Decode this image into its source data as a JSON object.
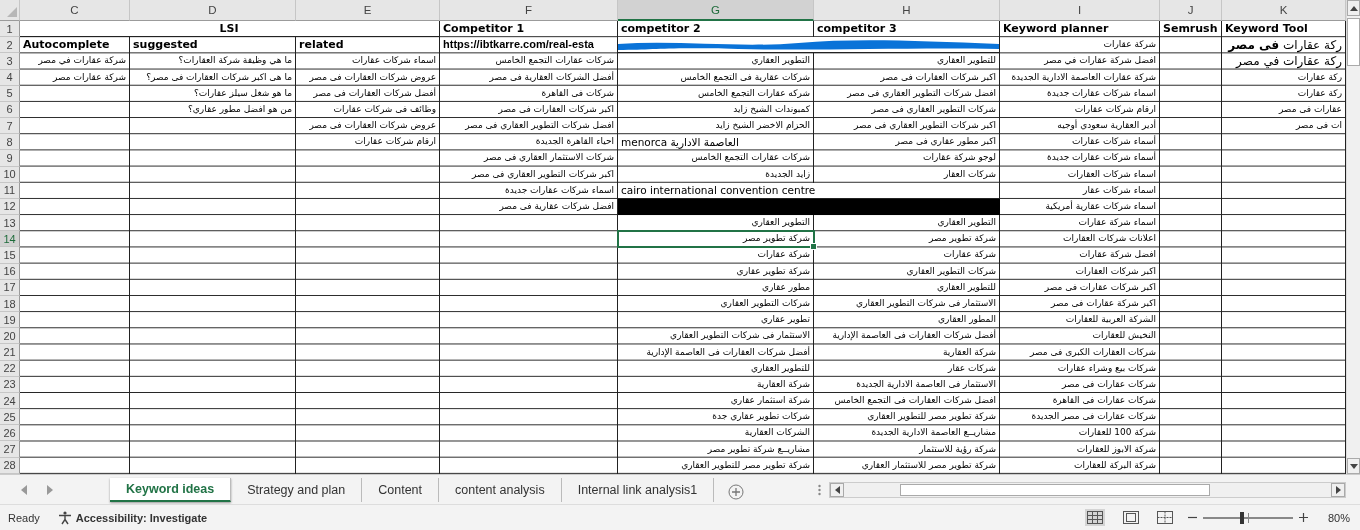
{
  "sheet": {
    "merged_heading": "LSI",
    "columns": [
      {
        "letter": "K",
        "selected": false,
        "heading": "Keyword Tool",
        "cells": [
          {
            "kind": "large",
            "text": "ركة عقارات **فى مصر**"
          },
          {
            "kind": "large",
            "text": "ركة عقارات في مصر"
          },
          {
            "kind": "text",
            "text": "ركة عقارات"
          },
          {
            "kind": "text",
            "text": "ركة عقارات"
          },
          {
            "kind": "text",
            "text": "عقارات فى مصر"
          },
          {
            "kind": "text",
            "text": "ات فى مصر"
          }
        ]
      },
      {
        "letter": "J",
        "selected": false,
        "heading": "Semrush"
      },
      {
        "letter": "I",
        "selected": false,
        "heading": "Keyword planner",
        "cells": [
          {
            "kind": "text",
            "text": "شركة عقارات"
          },
          {
            "kind": "text",
            "text": "افضل شركة عقارات في مصر"
          },
          {
            "kind": "text",
            "text": "شركة عقارات العاصمة الادارية الجديدة"
          },
          {
            "kind": "text",
            "text": "اسماء شركات عقارات جديدة"
          },
          {
            "kind": "text",
            "text": "ارقام شركات عقارات"
          },
          {
            "kind": "text",
            "text": "أدير العقارية سعودي أوجيه"
          },
          {
            "kind": "text",
            "text": "أسماء شركات عقارات"
          },
          {
            "kind": "text",
            "text": "أسماء شركات عقارات جديدة"
          },
          {
            "kind": "text",
            "text": "اسماء شركات العقارات"
          },
          {
            "kind": "text",
            "text": "اسماء شركات عقار"
          },
          {
            "kind": "text",
            "text": "اسماء شركات عقارية أمريكية"
          },
          {
            "kind": "text",
            "text": "اسماء شركة عقارات"
          },
          {
            "kind": "text",
            "text": "اعلانات شركات العقارات"
          },
          {
            "kind": "text",
            "text": "افضل شركة عقارات"
          },
          {
            "kind": "text",
            "text": "اكبر شركات العقارات"
          },
          {
            "kind": "text",
            "text": "اكبر شركات عقارات فى مصر"
          },
          {
            "kind": "text",
            "text": "اكبر شركة عقارات فى مصر"
          },
          {
            "kind": "text",
            "text": "الشركة العربية للعقارات"
          },
          {
            "kind": "text",
            "text": "النخيش للعقارات"
          },
          {
            "kind": "text",
            "text": "شركات العقارات الكبرى فى مصر"
          },
          {
            "kind": "text",
            "text": "شركات بيع وشراء عقارات"
          },
          {
            "kind": "text",
            "text": "شركات عقارات فى مصر"
          },
          {
            "kind": "text",
            "text": "شركات عقارات فى القاهرة"
          },
          {
            "kind": "text",
            "text": "شركات عقارات فى مصر الجديدة"
          },
          {
            "kind": "text",
            "text": "شركة 100 للعقارات"
          },
          {
            "kind": "text",
            "text": "شركة الابوز للعقارات"
          },
          {
            "kind": "text",
            "text": "شركة البركة للعقارات"
          }
        ]
      },
      {
        "letter": "H",
        "selected": false,
        "heading": "competitor 3",
        "cells": [
          {
            "kind": "covered"
          },
          {
            "kind": "text",
            "text": "للتطوير العقاري"
          },
          {
            "kind": "text",
            "text": "اكبر شركات العقارات فى مصر"
          },
          {
            "kind": "text",
            "text": "افضل شركات التطوير العقاري فى مصر"
          },
          {
            "kind": "text",
            "text": "شركات التطوير العقاري فى مصر"
          },
          {
            "kind": "text",
            "text": "اكبر شركات التطوير العقاري فى مصر"
          },
          {
            "kind": "text",
            "text": "اكبر مطور عقاري فى مصر"
          },
          {
            "kind": "text",
            "text": "لوجو شركة عقارات"
          },
          {
            "kind": "text",
            "text": "شركات العقار"
          },
          {
            "kind": "covered"
          },
          {
            "kind": "covered"
          },
          {
            "kind": "text",
            "text": "التطوير العقاري"
          },
          {
            "kind": "text",
            "text": "شركة تطوير مصر"
          },
          {
            "kind": "text",
            "text": "شركة عقارات"
          },
          {
            "kind": "text",
            "text": "شركات التطوير العقاري"
          },
          {
            "kind": "text",
            "text": "للتطوير العقاري"
          },
          {
            "kind": "text",
            "text": "الاستثمار فى شركات التطوير العقاري"
          },
          {
            "kind": "text",
            "text": "المطور العقاري"
          },
          {
            "kind": "text",
            "text": "أفضل شركات العقارات فى العاصمة الإدارية"
          },
          {
            "kind": "text",
            "text": "شركة العقارية"
          },
          {
            "kind": "text",
            "text": "شركات عقار"
          },
          {
            "kind": "text",
            "text": "الاستثمار فى العاصمة الادارية الجديدة"
          },
          {
            "kind": "text",
            "text": "افضل شركات العقارات فى التجمع الخامس"
          },
          {
            "kind": "text",
            "text": "شركة تطوير مصر للتطوير العقاري"
          },
          {
            "kind": "text",
            "text": "مشاريــع العاصمة الادارية الجديدة"
          },
          {
            "kind": "text",
            "text": "شركة رؤية للاستثمار"
          },
          {
            "kind": "text",
            "text": "شركة تطوير مصر للاستثمار العقاري"
          }
        ]
      },
      {
        "letter": "G",
        "selected": true,
        "heading": "competitor 2",
        "cells": [
          {
            "kind": "scribbled"
          },
          {
            "kind": "text",
            "text": "التطوير العقاري"
          },
          {
            "kind": "text",
            "text": "شركات عقارية فى التجمع الخامس"
          },
          {
            "kind": "text",
            "text": "شركه عقارات التجمع الخامس"
          },
          {
            "kind": "text",
            "text": "كمبوندات الشيخ زايد"
          },
          {
            "kind": "text",
            "text": "الحزام الاخضر الشيخ زايد"
          },
          {
            "kind": "latin",
            "text": "menorca العاصمة الادارية"
          },
          {
            "kind": "text",
            "text": "شركات عقارات التجمع الخامس"
          },
          {
            "kind": "text",
            "text": "زايد الجديدة"
          },
          {
            "kind": "latin-wide",
            "text": "cairo international convention centre"
          },
          {
            "kind": "redacted"
          },
          {
            "kind": "text",
            "text": "التطوير العقاري"
          },
          {
            "kind": "text",
            "text": "شركة تطوير مصر"
          },
          {
            "kind": "text",
            "text": "شركة عقارات"
          },
          {
            "kind": "text",
            "text": "شركة تطوير عقاري"
          },
          {
            "kind": "text",
            "text": "مطور عقاري"
          },
          {
            "kind": "text",
            "text": "شركات التطوير العقاري"
          },
          {
            "kind": "text",
            "text": "تطوير عقاري"
          },
          {
            "kind": "text",
            "text": "الاستثمار فى شركات التطوير العقاري"
          },
          {
            "kind": "text",
            "text": "أفضل شركات العقارات فى العاصمة الإدارية"
          },
          {
            "kind": "text",
            "text": "للتطوير العقاري"
          },
          {
            "kind": "text",
            "text": "شركة العقارية"
          },
          {
            "kind": "text",
            "text": "شركة استثمار عقاري"
          },
          {
            "kind": "text",
            "text": "شركات تطوير عقاري جدة"
          },
          {
            "kind": "text",
            "text": "الشركات العقارية"
          },
          {
            "kind": "text",
            "text": "مشاريــع شركة تطوير مصر"
          },
          {
            "kind": "text",
            "text": "شركة تطوير مصر للتطوير العقاري"
          }
        ]
      },
      {
        "letter": "F",
        "selected": false,
        "heading": "Competitor 1",
        "cells": [
          {
            "kind": "url",
            "text": "https://ibtkarre.com/real-esta"
          },
          {
            "kind": "text",
            "text": "شركات عقارات التجمع الخامس"
          },
          {
            "kind": "text",
            "text": "أفضل الشركات العقارية فى مصر"
          },
          {
            "kind": "text",
            "text": "شركات فى القاهرة"
          },
          {
            "kind": "text",
            "text": "اكبر شركات العقارات فى مصر"
          },
          {
            "kind": "text",
            "text": "افضل شركات التطوير العقاري فى مصر"
          },
          {
            "kind": "text",
            "text": "احياء القاهرة الجديدة"
          },
          {
            "kind": "text",
            "text": "شركات الاستثمار العقاري فى مصر"
          },
          {
            "kind": "text",
            "text": "اكبر شركات التطوير العقاري فى مصر"
          },
          {
            "kind": "text",
            "text": "اسماء شركات عقارات جديدة"
          },
          {
            "kind": "text",
            "text": "افضل شركات عقارية فى مصر"
          }
        ]
      },
      {
        "letter": "E",
        "selected": false,
        "cells": [
          {
            "kind": "subheading",
            "text": "related"
          },
          {
            "kind": "text",
            "text": "اسماء شركات عقارات"
          },
          {
            "kind": "text",
            "text": "عروض شركات العقارات فى مصر"
          },
          {
            "kind": "text",
            "text": "أفضل شركات العقارات فى مصر"
          },
          {
            "kind": "text",
            "text": "وظائف فى شركات عقارات"
          },
          {
            "kind": "text",
            "text": "عروض شركات العقارات فى مصر"
          },
          {
            "kind": "text",
            "text": "ارقام شركات عقارات"
          }
        ]
      },
      {
        "letter": "D",
        "selected": false,
        "cells": [
          {
            "kind": "subheading",
            "text": "suggested"
          },
          {
            "kind": "text",
            "text": "ما هي وظيفة شركة العقارات؟"
          },
          {
            "kind": "text",
            "text": "ما هى اكبر شركات العقارات فى مصر؟"
          },
          {
            "kind": "text",
            "text": "ما هو شغل سيلز عقارات؟"
          },
          {
            "kind": "text",
            "text": "من هو افضل مطور عقاري؟"
          }
        ]
      },
      {
        "letter": "C",
        "selected": false,
        "cells": [
          {
            "kind": "subheading",
            "text": "Autocomplete"
          },
          {
            "kind": "text",
            "text": "شركة عقارات في مصر"
          },
          {
            "kind": "text",
            "text": "شركة عقارات مصر"
          }
        ]
      }
    ],
    "row_numbers": [
      {
        "n": "1",
        "selected": false
      },
      {
        "n": "2",
        "selected": false
      },
      {
        "n": "3",
        "selected": false
      },
      {
        "n": "4",
        "selected": false
      },
      {
        "n": "5",
        "selected": false
      },
      {
        "n": "6",
        "selected": false
      },
      {
        "n": "7",
        "selected": false
      },
      {
        "n": "8",
        "selected": false
      },
      {
        "n": "9",
        "selected": false
      },
      {
        "n": "10",
        "selected": false
      },
      {
        "n": "11",
        "selected": false
      },
      {
        "n": "12",
        "selected": false
      },
      {
        "n": "13",
        "selected": false
      },
      {
        "n": "14",
        "selected": true
      },
      {
        "n": "15",
        "selected": false
      },
      {
        "n": "16",
        "selected": false
      },
      {
        "n": "17",
        "selected": false
      },
      {
        "n": "18",
        "selected": false
      },
      {
        "n": "19",
        "selected": false
      },
      {
        "n": "20",
        "selected": false
      },
      {
        "n": "21",
        "selected": false
      },
      {
        "n": "22",
        "selected": false
      },
      {
        "n": "23",
        "selected": false
      },
      {
        "n": "24",
        "selected": false
      },
      {
        "n": "25",
        "selected": false
      },
      {
        "n": "26",
        "selected": false
      },
      {
        "n": "27",
        "selected": false
      },
      {
        "n": "28",
        "selected": false
      }
    ]
  },
  "tabs": [
    {
      "label": "Internal link analysis1",
      "selected": false
    },
    {
      "label": "content analysis",
      "selected": false
    },
    {
      "label": "Content",
      "selected": false
    },
    {
      "label": "Strategy and plan",
      "selected": false
    },
    {
      "label": "Keyword ideas",
      "selected": true
    }
  ],
  "status_bar": {
    "status": "Ready",
    "accessibility": "Accessibility: Investigate",
    "zoom": "80%",
    "zoom_slider": {
      "level": 0.43
    }
  }
}
